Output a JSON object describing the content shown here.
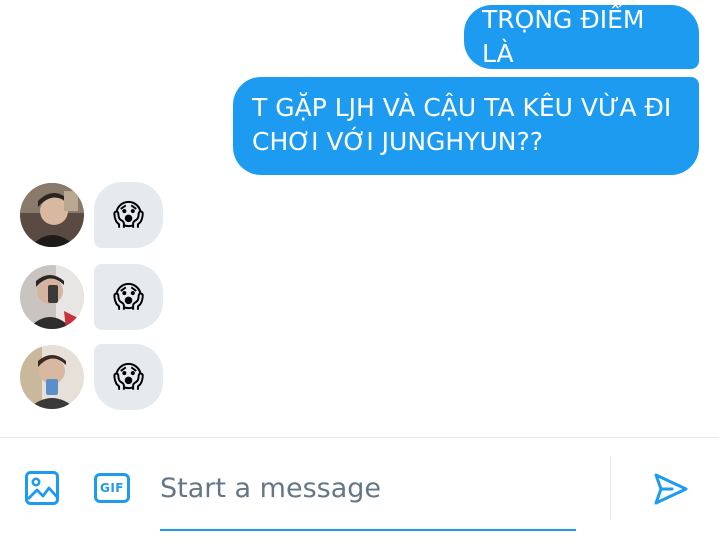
{
  "conversation": {
    "outgoing": [
      {
        "text": "TRỌNG ĐIỂM LÀ"
      },
      {
        "text": "T GẶP LJH VÀ CẬU TA KÊU VỪA ĐI\nCHƠI VỚI JUNGHYUN??"
      }
    ],
    "incoming": [
      {
        "emoji": "😱",
        "avatar": "avatar-1"
      },
      {
        "emoji": "😱",
        "avatar": "avatar-2"
      },
      {
        "emoji": "😱",
        "avatar": "avatar-3"
      }
    ]
  },
  "composer": {
    "placeholder": "Start a message",
    "gif_label": "GIF",
    "icons": [
      "image-icon",
      "gif-icon",
      "send-icon"
    ]
  },
  "colors": {
    "accent": "#1d9bf0",
    "incoming_bubble": "#e5eaef",
    "placeholder": "#657786"
  }
}
